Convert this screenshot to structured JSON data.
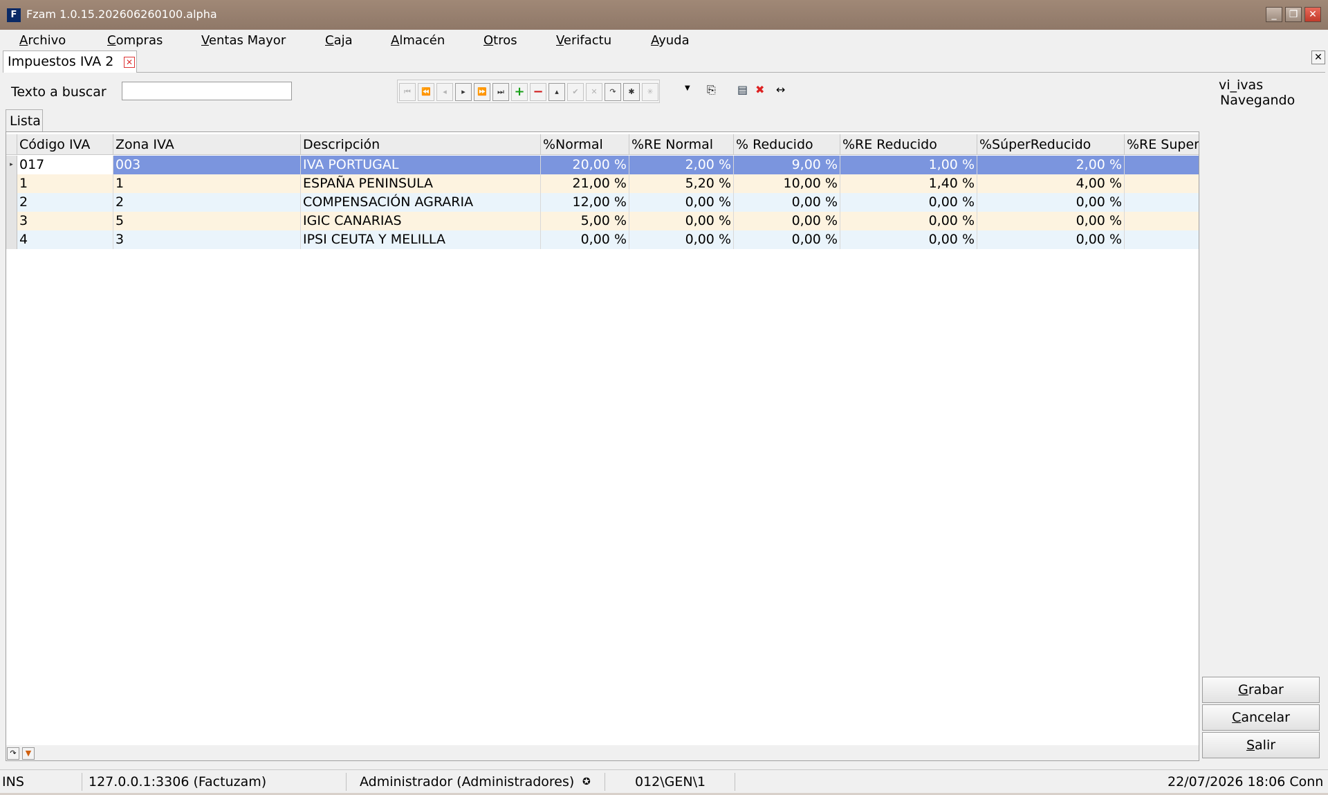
{
  "window": {
    "title": "Fzam 1.0.15.202606260100.alpha",
    "logo": "F",
    "controls": [
      "minimize-icon",
      "restore-icon",
      "close-icon"
    ]
  },
  "menu": [
    "Archivo",
    "Compras",
    "Ventas Mayor",
    "Caja",
    "Almacén",
    "Otros",
    "Verifactu",
    "Ayuda"
  ],
  "doc_tab": {
    "label": "Impuestos IVA 2"
  },
  "search": {
    "label": "Texto a buscar",
    "value": ""
  },
  "navigator": [
    "first-icon",
    "prior-page-icon",
    "prior-icon",
    "next-icon",
    "next-page-icon",
    "last-icon",
    "insert-icon",
    "delete-icon",
    "edit-icon",
    "post-icon",
    "cancel-icon",
    "refresh-icon",
    "apply-updates-icon",
    "cancel-updates-icon"
  ],
  "toolbar_icons": [
    "dropdown-icon",
    "export-icon",
    "columns-icon",
    "clear-filter-icon",
    "resize-columns-icon"
  ],
  "dataset": {
    "name": "vi_ivas",
    "state": "Navegando"
  },
  "list_tab": {
    "label": "Lista"
  },
  "table": {
    "columns": [
      "Código IVA",
      "Zona IVA",
      "Descripción",
      "%Normal",
      "%RE Normal",
      "% Reducido",
      "%RE Reducido",
      "%SúperReducido",
      "%RE SuperR"
    ],
    "rows": [
      [
        "017",
        "003",
        "IVA PORTUGAL",
        "20,00 %",
        "2,00 %",
        "9,00 %",
        "1,00 %",
        "2,00 %",
        ""
      ],
      [
        "1",
        "1",
        "ESPAÑA PENINSULA",
        "21,00 %",
        "5,20 %",
        "10,00 %",
        "1,40 %",
        "4,00 %",
        ""
      ],
      [
        "2",
        "2",
        "COMPENSACIÓN AGRARIA",
        "12,00 %",
        "0,00 %",
        "0,00 %",
        "0,00 %",
        "0,00 %",
        ""
      ],
      [
        "3",
        "5",
        "IGIC CANARIAS",
        "5,00 %",
        "0,00 %",
        "0,00 %",
        "0,00 %",
        "0,00 %",
        ""
      ],
      [
        "4",
        "3",
        "IPSI CEUTA Y MELILLA",
        "0,00 %",
        "0,00 %",
        "0,00 %",
        "0,00 %",
        "0,00 %",
        ""
      ]
    ],
    "selected_row": 0
  },
  "buttons": {
    "save": "Grabar",
    "cancel": "Cancelar",
    "exit": "Salir"
  },
  "status": {
    "mode": "INS",
    "connection": "127.0.0.1:3306 (Factuzam)",
    "user": "Administrador (Administradores)",
    "path": "012\\GEN\\1",
    "datetime": "22/07/2026 18:06 Conn"
  }
}
